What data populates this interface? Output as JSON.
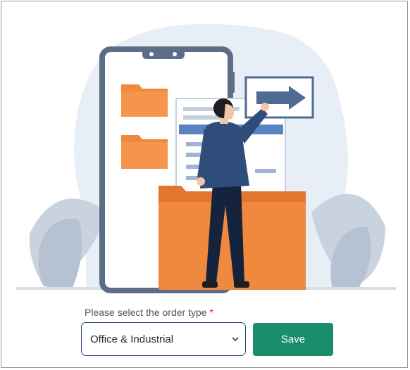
{
  "form": {
    "order_type_label": "Please select the order type",
    "required_marker": "*",
    "order_type_value": "Office & Industrial",
    "save_label": "Save"
  },
  "icons": {
    "dropdown": "chevron-down-icon"
  },
  "colors": {
    "save_button": "#1a8e6b",
    "select_border": "#2f4a7a",
    "required": "#e02424",
    "folder": "#f0883e",
    "phone_frame": "#5b6e86"
  }
}
